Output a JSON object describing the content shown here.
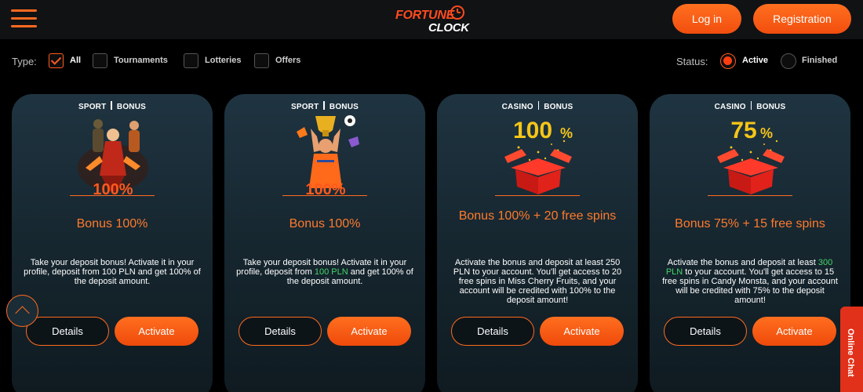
{
  "header": {
    "menu_icon": "hamburger-icon",
    "logo_top": "FORTUNE",
    "logo_bottom": "CLOCK",
    "login_label": "Log in",
    "registration_label": "Registration"
  },
  "filters": {
    "type_label": "Type:",
    "type_options": [
      {
        "label": "All",
        "checked": true
      },
      {
        "label": "Tournaments",
        "checked": false
      },
      {
        "label": "Lotteries",
        "checked": false
      },
      {
        "label": "Offers",
        "checked": false
      }
    ],
    "status_label": "Status:",
    "status_options": [
      {
        "label": "Active",
        "selected": true
      },
      {
        "label": "Finished",
        "selected": false
      }
    ]
  },
  "cards": [
    {
      "tag1": "SPORT",
      "tag2": "BONUS",
      "art_text": "100%",
      "title": "Bonus 100%",
      "desc": "Take your deposit bonus! Activate it in your profile, deposit from 100 PLN and get 100% of the deposit amount.",
      "details_label": "Details",
      "activate_label": "Activate"
    },
    {
      "tag1": "SPORT",
      "tag2": "BONUS",
      "art_text": "100%",
      "title": "Bonus 100%",
      "desc_pre": "Take your deposit bonus! Activate it in your profile, deposit from ",
      "desc_hl": "100 PLN",
      "desc_post": " and get 100% of the deposit amount.",
      "details_label": "Details",
      "activate_label": "Activate"
    },
    {
      "tag1": "CASINO",
      "tag2": "BONUS",
      "art_text": "100",
      "art_pct": "%",
      "title": "Bonus 100% + 20 free spins",
      "desc": "Activate the bonus and deposit at least 250 PLN to your account. You'll get access to 20 free spins in Miss Cherry Fruits, and your account will be credited with 100% to the deposit amount!",
      "details_label": "Details",
      "activate_label": "Activate"
    },
    {
      "tag1": "CASINO",
      "tag2": "BONUS",
      "art_text": "75",
      "art_pct": "%",
      "title": "Bonus 75% + 15 free spins",
      "desc_pre": "Activate the bonus and deposit at least ",
      "desc_hl": "300 PLN",
      "desc_post": " to your account. You'll get access to 15 free spins in Candy Monsta, and your account will be credited with 75% to the deposit amount!",
      "details_label": "Details",
      "activate_label": "Activate"
    }
  ],
  "scroll_top_icon": "chevron-up-icon",
  "online_chat_label": "Online Chat",
  "colors": {
    "accent": "#ff6a1f",
    "highlight": "#44d66a",
    "chat": "#e1311a"
  }
}
